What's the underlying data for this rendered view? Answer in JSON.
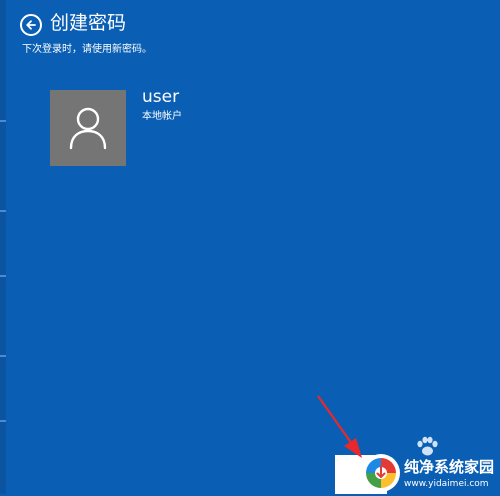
{
  "header": {
    "title": "创建密码",
    "subtitle": "下次登录时，请使用新密码。"
  },
  "account": {
    "user_name": "user",
    "account_type": "本地帐户"
  },
  "watermark": {
    "site_name": "纯净系统家园",
    "url": "www.yidaimei.com"
  },
  "colors": {
    "background": "#0a5fb4",
    "avatar_bg": "#757575",
    "annotation_arrow": "#e8282b"
  },
  "icons": {
    "back": "back-arrow-circle-icon",
    "avatar": "user-silhouette-icon"
  }
}
